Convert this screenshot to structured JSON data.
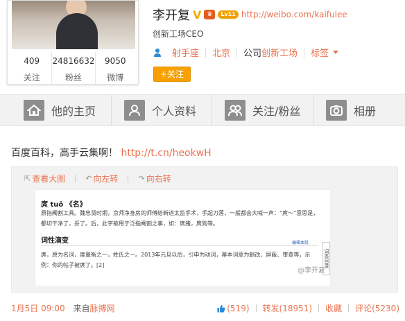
{
  "profile": {
    "name": "李开复",
    "level_badge": "Lv11",
    "url": "http://weibo.com/kaifulee",
    "title": "创新工场CEO",
    "info": {
      "sign": "射手座",
      "city": "北京",
      "company_prefix": "公司",
      "company": "创新工场",
      "tags": "标签"
    },
    "follow_button": "+关注",
    "stats": [
      {
        "num": "409",
        "label": "关注"
      },
      {
        "num": "24816632",
        "label": "粉丝"
      },
      {
        "num": "9050",
        "label": "微博"
      }
    ]
  },
  "nav": {
    "tabs": [
      {
        "label": "他的主页",
        "icon": "house-icon"
      },
      {
        "label": "个人资料",
        "icon": "person-icon"
      },
      {
        "label": "关注/粉丝",
        "icon": "people-icon"
      },
      {
        "label": "相册",
        "icon": "camera-icon"
      }
    ]
  },
  "post": {
    "text": "百度百科，高手云集啊！",
    "link": "http://t.cn/heokwH",
    "tools": {
      "view_large": "查看大图",
      "rotate_left": "向左转",
      "rotate_right": "向右转"
    },
    "doc": {
      "heading": "庹 tuǒ 《名》",
      "para1": "原指阉割工具。魏忠贤时期，京师净身房的师傅给新进太监手术，手起刀落，一般都会大喊一声：“庹～”意思是，都切干净了，妥了。后，此字被用于泛指阉割之事，如：庹猪，庹狗等。",
      "subheading": "词性演变",
      "edit_link": "编辑本段",
      "para2": "庹，原为名词，度量衡之一，姓氏之一。2013年元旦以后，引申为动词，基本词意为删改、屏蔽、审查等，示例：你的帖子被庹了。[2]",
      "side_label": "词条目录",
      "watermark": "@李开复"
    },
    "time": "1月5日 09:00",
    "from_prefix": "来自",
    "source": "脉搏网",
    "likes": "(519)",
    "repost": "转发(18951)",
    "favorite": "收藏",
    "comment": "评论(5230)"
  },
  "colors": {
    "accent": "#eb7350",
    "follow": "#f7a000",
    "nav_bg": "#f2f2f2"
  }
}
